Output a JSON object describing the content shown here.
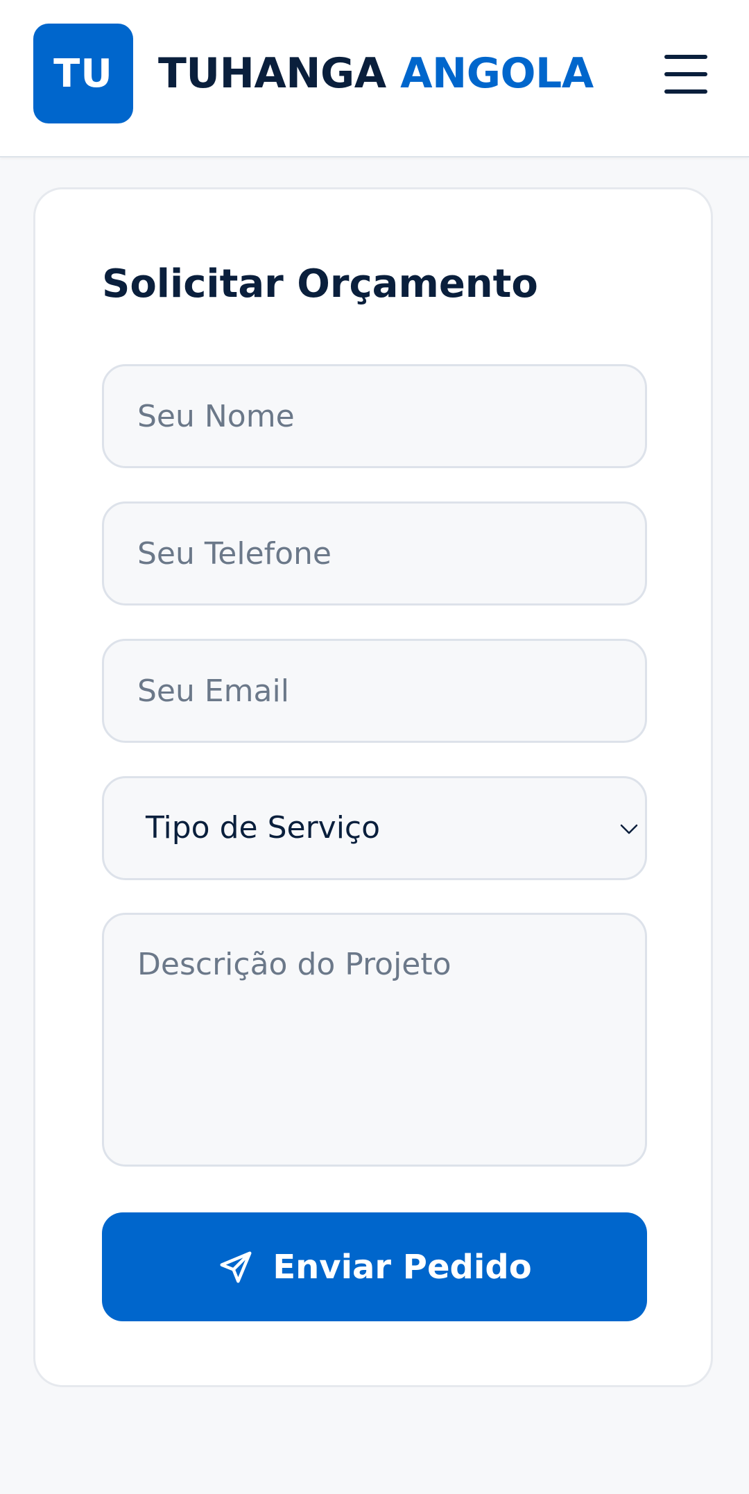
{
  "header": {
    "logo_initials": "TU",
    "brand_part1": "TUHANGA",
    "brand_part2": "ANGOLA",
    "menu_icon": "hamburger-menu-icon"
  },
  "form": {
    "title": "Solicitar Orçamento",
    "name_placeholder": "Seu Nome",
    "phone_placeholder": "Seu Telefone",
    "email_placeholder": "Seu Email",
    "service_select": {
      "selected": "Tipo de Serviço",
      "icon": "chevron-down-icon"
    },
    "description_placeholder": "Descrição do Projeto",
    "submit_label": "Enviar Pedido",
    "submit_icon": "send-paper-plane-icon"
  },
  "colors": {
    "primary": "#0066cc",
    "navy": "#0a1f3c",
    "background": "#f7f8fa",
    "field_background": "#f7f8fa",
    "placeholder": "#6b7889"
  }
}
